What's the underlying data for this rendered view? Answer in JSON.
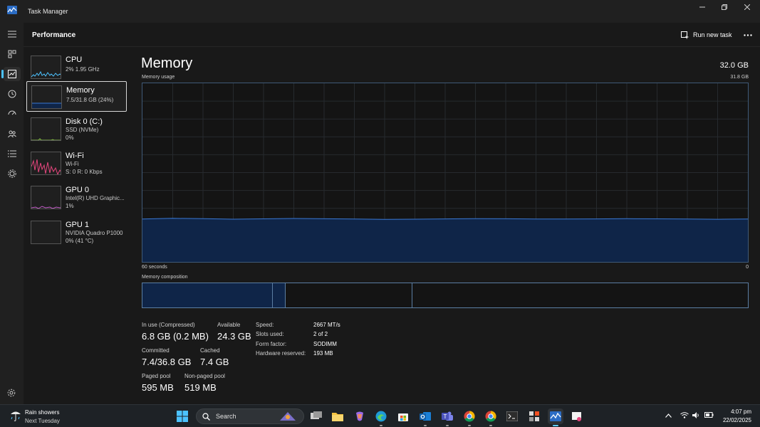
{
  "window": {
    "title": "Task Manager"
  },
  "header": {
    "page_title": "Performance",
    "run_task_label": "Run new task"
  },
  "devices": [
    {
      "name": "CPU",
      "line1": "2%  1.95 GHz",
      "line2": "",
      "graph_color": "#4cc2ff"
    },
    {
      "name": "Memory",
      "line1": "7.5/31.8 GB (24%)",
      "line2": "",
      "graph_color": "#3a78d4"
    },
    {
      "name": "Disk 0 (C:)",
      "line1": "SSD (NVMe)",
      "line2": "0%",
      "graph_color": "#8bc34a"
    },
    {
      "name": "Wi-Fi",
      "line1": "Wi-Fi",
      "line2": "S: 0  R: 0 Kbps",
      "graph_color": "#e3457c"
    },
    {
      "name": "GPU 0",
      "line1": "Intel(R) UHD Graphic...",
      "line2": "1%",
      "graph_color": "#c45ec9"
    },
    {
      "name": "GPU 1",
      "line1": "NVIDIA Quadro P1000",
      "line2": "0%  (41 °C)",
      "graph_color": "#c45ec9"
    }
  ],
  "memory": {
    "title": "Memory",
    "total": "32.0 GB",
    "usage_label": "Memory usage",
    "usage_max": "31.8 GB",
    "time_left": "60 seconds",
    "time_right": "0",
    "composition_label": "Memory composition",
    "usage_fraction": 0.24,
    "stats": {
      "in_use_label": "In use (Compressed)",
      "in_use_value": "6.8 GB (0.2 MB)",
      "available_label": "Available",
      "available_value": "24.3 GB",
      "committed_label": "Committed",
      "committed_value": "7.4/36.8 GB",
      "cached_label": "Cached",
      "cached_value": "7.4 GB",
      "paged_label": "Paged pool",
      "paged_value": "595 MB",
      "nonpaged_label": "Non-paged pool",
      "nonpaged_value": "519 MB"
    },
    "specs": {
      "speed_label": "Speed:",
      "speed_value": "2667 MT/s",
      "slots_label": "Slots used:",
      "slots_value": "2 of 2",
      "form_label": "Form factor:",
      "form_value": "SODIMM",
      "reserved_label": "Hardware reserved:",
      "reserved_value": "193 MB"
    }
  },
  "taskbar": {
    "weather_main": "Rain showers",
    "weather_sub": "Next Tuesday",
    "search_placeholder": "Search",
    "time": "4:07 pm",
    "date": "22/02/2025"
  },
  "colors": {
    "accent": "#4cc2ff",
    "memory_fill": "#0f2548",
    "memory_line": "#3a78d4"
  }
}
